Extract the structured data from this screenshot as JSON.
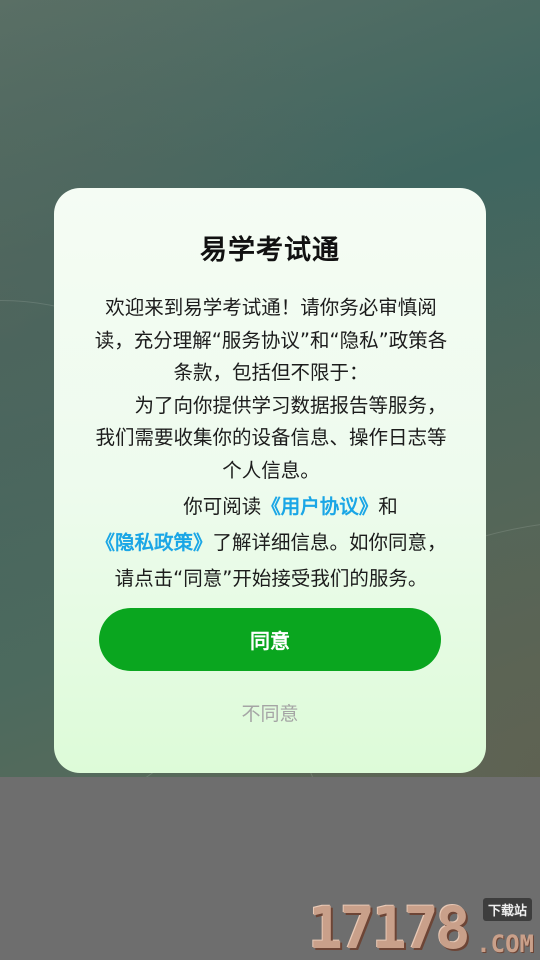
{
  "dialog": {
    "title": "易学考试通",
    "paragraph1": "欢迎来到易学考试通！请你务必审慎阅读，充分理解“服务协议”和“隐私”政策各条款，包括但不限于：",
    "paragraph2": "为了向你提供学习数据报告等服务，我们需要收集你的设备信息、操作日志等个人信息。",
    "paragraph3_prefix": "你可阅读",
    "user_agreement_link": "《用户协议》",
    "paragraph3_and": "和",
    "privacy_policy_link": "《隐私政策》",
    "paragraph3_suffix": "了解详细信息。如你同意，请点击“同意”开始接受我们的服务。",
    "agree_label": "同意",
    "disagree_label": "不同意"
  },
  "watermark": {
    "digits": "17178",
    "suffix": ".COM",
    "badge": "下载站"
  },
  "colors": {
    "link": "#1aa6e6",
    "agree_button": "#0aa61f",
    "disagree_text": "#a5a5a5"
  }
}
